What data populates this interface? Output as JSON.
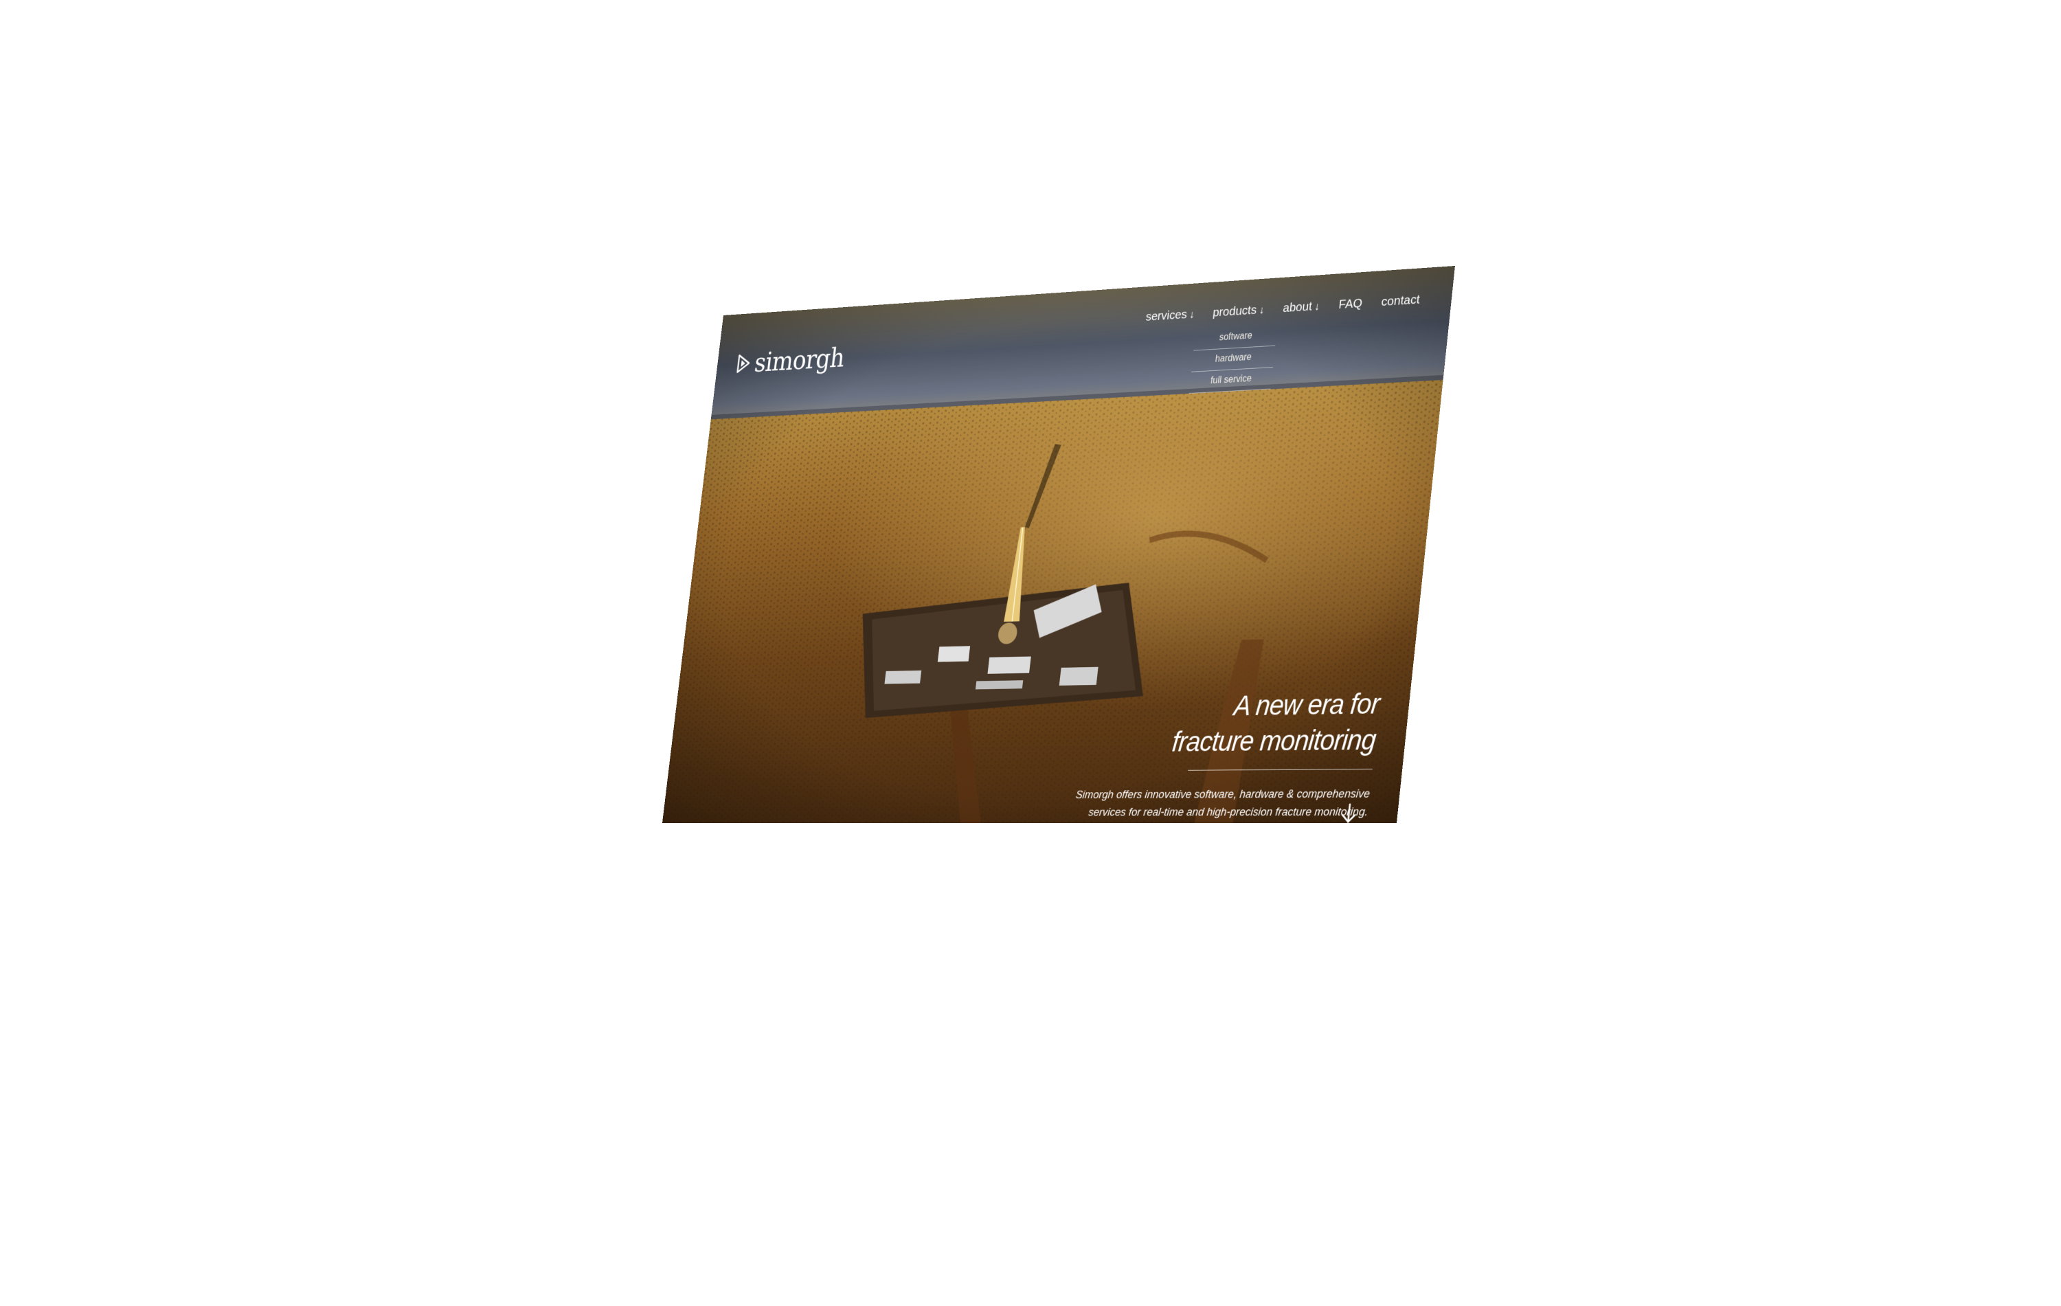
{
  "brand": {
    "name": "simorgh",
    "logo_icon": "play-triangle-icon"
  },
  "nav": {
    "items": [
      {
        "label": "services",
        "icon": "arrow-down-icon"
      },
      {
        "label": "products",
        "icon": "arrow-down-icon"
      },
      {
        "label": "about",
        "icon": "arrow-down-icon"
      },
      {
        "label": "FAQ"
      },
      {
        "label": "contact"
      }
    ],
    "products_dropdown": [
      "software",
      "hardware",
      "full service"
    ]
  },
  "hero": {
    "headline_line1": "A new era for",
    "headline_line2": "fracture monitoring",
    "subtext_line1": "Simorgh offers innovative software, hardware & comprehensive",
    "subtext_line2": "services for real-time and high-precision fracture monitoring.",
    "scroll_icon": "arrow-down-icon"
  },
  "colors": {
    "background": "#ffffff",
    "text": "#ffffff",
    "sky": "#4e5563",
    "desert": "#8a5a24"
  }
}
